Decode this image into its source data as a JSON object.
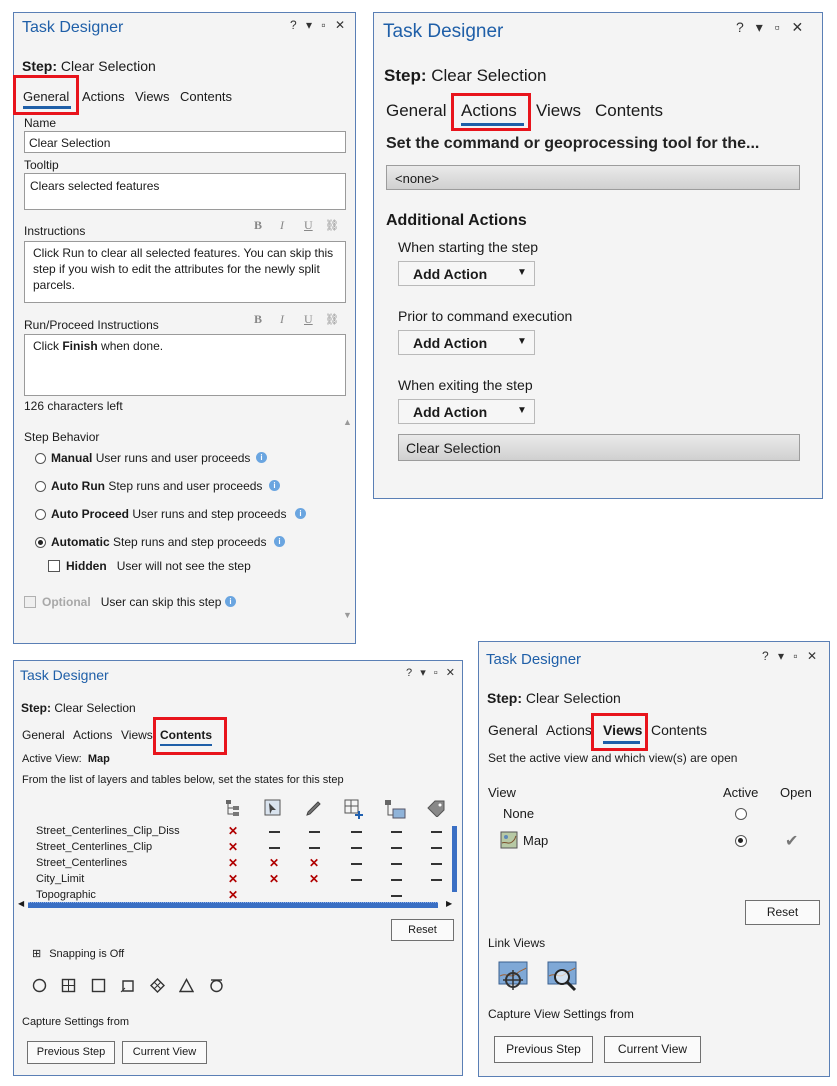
{
  "panel_title": "Task Designer",
  "window_controls": {
    "help": "?",
    "dropdown": "▾",
    "maximize": "▫",
    "close": "✕"
  },
  "step_label": "Step:",
  "step_name": "Clear Selection",
  "tabs": {
    "general": "General",
    "actions": "Actions",
    "views": "Views",
    "contents": "Contents"
  },
  "accent_color": "#1f5fa8",
  "highlight_color": "#e8141c",
  "general": {
    "name_label": "Name",
    "name_value": "Clear Selection",
    "tooltip_label": "Tooltip",
    "tooltip_value": "Clears selected features",
    "instructions_label": "Instructions",
    "format_bold": "B",
    "format_italic": "I",
    "format_underline": "U",
    "instructions_lines": [
      "Click Run to clear all selected features. You can skip this",
      "step if you wish to edit the attributes for the newly split",
      "parcels."
    ],
    "run_label": "Run/Proceed Instructions",
    "run_prefix": "Click ",
    "run_bold": "Finish",
    "run_suffix": " when done.",
    "chars_left": "126 characters left",
    "behavior_label": "Step Behavior",
    "behaviors": [
      {
        "name": "Manual",
        "desc": "User runs and user proceeds",
        "selected": false
      },
      {
        "name": "Auto Run",
        "desc": "Step runs and user proceeds",
        "selected": false
      },
      {
        "name": "Auto Proceed",
        "desc": "User runs and step proceeds",
        "selected": false
      },
      {
        "name": "Automatic",
        "desc": "Step runs and step proceeds",
        "selected": true
      }
    ],
    "hidden_name": "Hidden",
    "hidden_desc": "User will not see the step",
    "optional_name": "Optional",
    "optional_desc": "User can skip this step"
  },
  "actions": {
    "command_prompt": "Set the command or geoprocessing tool for the...",
    "command_value": "<none>",
    "additional_title": "Additional Actions",
    "starting_label": "When starting the step",
    "prior_label": "Prior to command execution",
    "exiting_label": "When exiting the step",
    "add_action": "Add Action",
    "exiting_value": "Clear Selection"
  },
  "contents": {
    "active_view_label": "Active View:",
    "active_view_value": "Map",
    "instructions": "From the list of layers and tables below, set the states for this step",
    "column_icons": [
      "layer-visibility-icon",
      "selectable-icon",
      "editable-icon",
      "snapping-icon",
      "table-icon",
      "label-icon"
    ],
    "layers": [
      {
        "name": "Street_Centerlines_Clip_Diss",
        "states": [
          "x",
          "-",
          "-",
          "-",
          "-",
          "-"
        ]
      },
      {
        "name": "Street_Centerlines_Clip",
        "states": [
          "x",
          "-",
          "-",
          "-",
          "-",
          "-"
        ]
      },
      {
        "name": "Street_Centerlines",
        "states": [
          "x",
          "x",
          "x",
          "-",
          "-",
          "-"
        ]
      },
      {
        "name": "City_Limit",
        "states": [
          "x",
          "x",
          "x",
          "-",
          "-",
          "-"
        ]
      },
      {
        "name": "Topographic",
        "states": [
          "x",
          "",
          "",
          "",
          "-",
          ""
        ]
      }
    ],
    "reset": "Reset",
    "snapping": "Snapping is Off",
    "snap_icons": [
      "point-snap-icon",
      "vertex-snap-icon",
      "edge-snap-icon",
      "end-snap-icon",
      "intersection-snap-icon",
      "midpoint-snap-icon",
      "tangent-snap-icon"
    ],
    "capture": "Capture Settings from",
    "previous_step": "Previous Step",
    "current_view": "Current View"
  },
  "views": {
    "instructions": "Set the active view and which view(s) are open",
    "col_view": "View",
    "col_active": "Active",
    "col_open": "Open",
    "rows": [
      {
        "name": "None",
        "active": false,
        "open": false
      },
      {
        "name": "Map",
        "active": true,
        "open": true
      }
    ],
    "reset": "Reset",
    "link_views": "Link Views",
    "link_icons": [
      "link-pan-icon",
      "link-zoom-icon"
    ],
    "capture": "Capture View Settings from",
    "previous_step": "Previous Step",
    "current_view": "Current View"
  }
}
